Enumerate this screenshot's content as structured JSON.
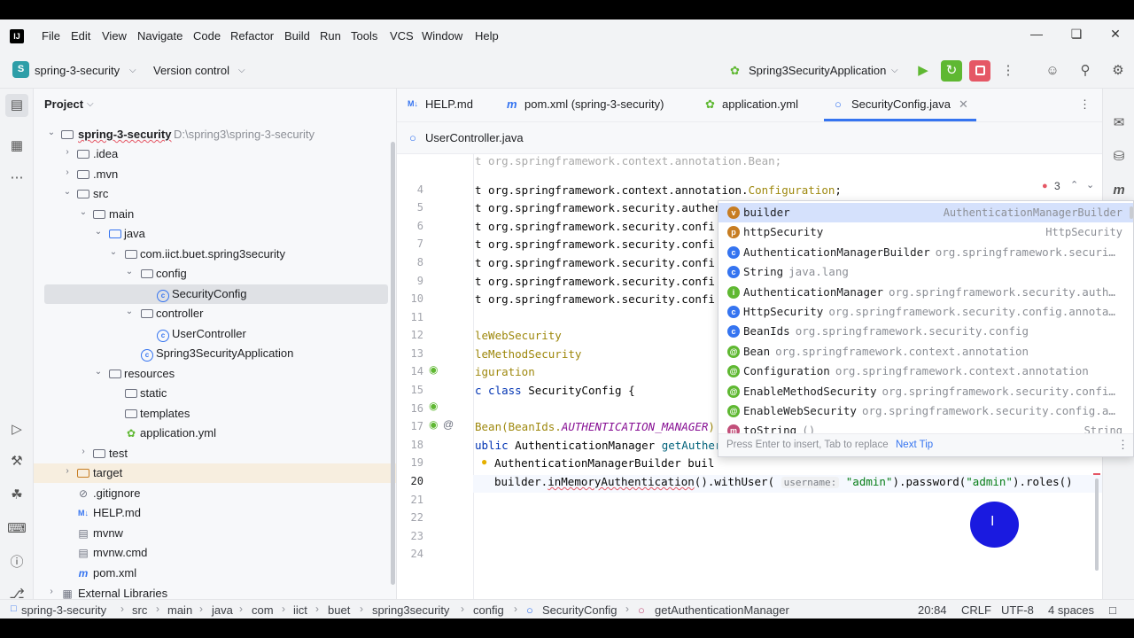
{
  "menu": {
    "items": [
      "File",
      "Edit",
      "View",
      "Navigate",
      "Code",
      "Refactor",
      "Build",
      "Run",
      "Tools",
      "VCS",
      "Window",
      "Help"
    ]
  },
  "toolbar": {
    "project_badge": "S",
    "project_name": "spring-3-security",
    "version_control": "Version control",
    "run_config": "Spring3SecurityApplication"
  },
  "project_panel": {
    "title": "Project",
    "tree": [
      {
        "label": "spring-3-security",
        "path": "D:\\spring3\\spring-3-security"
      },
      {
        "label": ".idea"
      },
      {
        "label": ".mvn"
      },
      {
        "label": "src"
      },
      {
        "label": "main"
      },
      {
        "label": "java"
      },
      {
        "label": "com.iict.buet.spring3security"
      },
      {
        "label": "config"
      },
      {
        "label": "SecurityConfig"
      },
      {
        "label": "controller"
      },
      {
        "label": "UserController"
      },
      {
        "label": "Spring3SecurityApplication"
      },
      {
        "label": "resources"
      },
      {
        "label": "static"
      },
      {
        "label": "templates"
      },
      {
        "label": "application.yml"
      },
      {
        "label": "test"
      },
      {
        "label": "target"
      },
      {
        "label": ".gitignore"
      },
      {
        "label": "HELP.md"
      },
      {
        "label": "mvnw"
      },
      {
        "label": "mvnw.cmd"
      },
      {
        "label": "pom.xml"
      },
      {
        "label": "External Libraries"
      }
    ]
  },
  "tabs": {
    "row1": [
      {
        "label": "HELP.md",
        "prefix": "M↓"
      },
      {
        "label": "pom.xml (spring-3-security)",
        "prefix": "m"
      },
      {
        "label": "application.yml"
      },
      {
        "label": "SecurityConfig.java"
      }
    ],
    "row2": [
      {
        "label": "UserController.java"
      }
    ]
  },
  "editor": {
    "error_count": "3",
    "line_numbers": [
      "4",
      "5",
      "6",
      "7",
      "8",
      "9",
      "10",
      "11",
      "12",
      "13",
      "14",
      "15",
      "16",
      "17",
      "18",
      "19",
      "20",
      "21",
      "22",
      "23",
      "24"
    ],
    "code": {
      "l4_a": "t org.springframework.context.annotation.",
      "l4_b": "Configuration",
      "l4_c": ";",
      "l5": "t org.springframework.security.authentication.AuthenticationManager;",
      "l6": "t org.springframework.security.confi",
      "l7": "t org.springframework.security.confi",
      "l8": "t org.springframework.security.confi",
      "l9": "t org.springframework.security.confi",
      "l10": "t org.springframework.security.confi",
      "l12": "leWebSecurity",
      "l13": "leMethodSecurity",
      "l14": "iguration",
      "l15_a": "c class ",
      "l15_b": "SecurityConfig {",
      "l17_a": "Bean(BeanIds.",
      "l17_b": "AUTHENTICATION_MANAGER",
      "l17_c": ")",
      "l18_a": "ublic ",
      "l18_b": "AuthenticationManager ",
      "l18_c": "getAuther",
      "l19": "AuthenticationManagerBuilder buil",
      "l20_a": "builder.",
      "l20_b": "inMemoryAuthentication",
      "l20_c": "().withUser(",
      "l20_hint": "username:",
      "l20_d": "\"admin\"",
      "l20_e": ").password(",
      "l20_f": "\"admin\"",
      "l20_g": ").roles()"
    }
  },
  "completion": {
    "items": [
      {
        "icon": "v",
        "name": "builder",
        "detail": "",
        "type": "AuthenticationManagerBuilder",
        "color": "#c77d22"
      },
      {
        "icon": "p",
        "name": "httpSecurity",
        "detail": "",
        "type": "HttpSecurity",
        "color": "#c77d22"
      },
      {
        "icon": "c",
        "name": "AuthenticationManagerBuilder",
        "detail": "org.springframework.securi…",
        "type": "",
        "color": "#3574f0"
      },
      {
        "icon": "c",
        "name": "String",
        "detail": "java.lang",
        "type": "",
        "color": "#3574f0"
      },
      {
        "icon": "i",
        "name": "AuthenticationManager",
        "detail": "org.springframework.security.auth…",
        "type": "",
        "color": "#5fb832"
      },
      {
        "icon": "c",
        "name": "HttpSecurity",
        "detail": "org.springframework.security.config.annota…",
        "type": "",
        "color": "#3574f0"
      },
      {
        "icon": "c",
        "name": "BeanIds",
        "detail": "org.springframework.security.config",
        "type": "",
        "color": "#3574f0"
      },
      {
        "icon": "@",
        "name": "Bean",
        "detail": "org.springframework.context.annotation",
        "type": "",
        "color": "#5fb832"
      },
      {
        "icon": "@",
        "name": "Configuration",
        "detail": "org.springframework.context.annotation",
        "type": "",
        "color": "#5fb832"
      },
      {
        "icon": "@",
        "name": "EnableMethodSecurity",
        "detail": "org.springframework.security.confi…",
        "type": "",
        "color": "#5fb832"
      },
      {
        "icon": "@",
        "name": "EnableWebSecurity",
        "detail": "org.springframework.security.config.a…",
        "type": "",
        "color": "#5fb832"
      },
      {
        "icon": "m",
        "name": "toString",
        "detail": "()",
        "type": "String",
        "color": "#c24f7a"
      }
    ],
    "footer_text": "Press Enter to insert, Tab to replace",
    "footer_link": "Next Tip"
  },
  "statusbar": {
    "breadcrumb": [
      "spring-3-security",
      "src",
      "main",
      "java",
      "com",
      "iict",
      "buet",
      "spring3security",
      "config",
      "SecurityConfig",
      "getAuthenticationManager"
    ],
    "position": "20:84",
    "line_ending": "CRLF",
    "encoding": "UTF-8",
    "indent": "4 spaces"
  },
  "colors": {
    "accent": "#3574f0",
    "selection": "#d5e1fc",
    "run_green": "#5fb832",
    "stop_red": "#e55765"
  }
}
